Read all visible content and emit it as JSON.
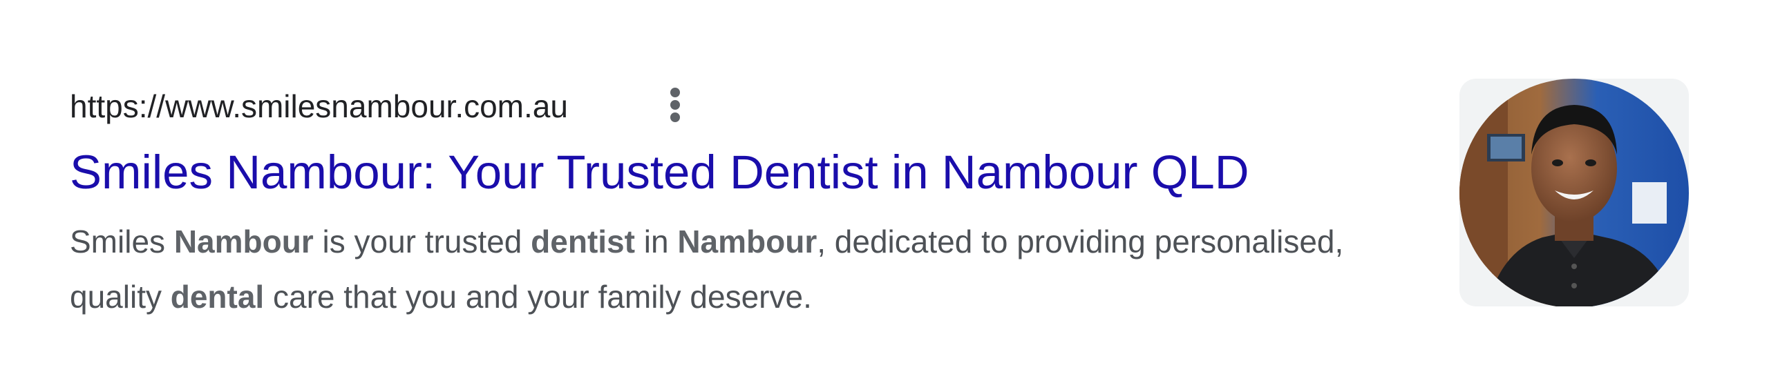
{
  "result": {
    "url": "https://www.smilesnambour.com.au",
    "more_icon": "three-dots-vertical-icon",
    "title": "Smiles Nambour: Your Trusted Dentist in Nambour QLD",
    "snippet": [
      {
        "text": "Smiles ",
        "bold": false
      },
      {
        "text": "Nambour",
        "bold": true
      },
      {
        "text": " is your trusted ",
        "bold": false
      },
      {
        "text": "dentist",
        "bold": true
      },
      {
        "text": " in ",
        "bold": false
      },
      {
        "text": "Nambour",
        "bold": true
      },
      {
        "text": ", dedicated to providing personalised, quality ",
        "bold": false
      },
      {
        "text": "dental",
        "bold": true
      },
      {
        "text": " care that you and your family deserve.",
        "bold": false
      }
    ],
    "thumbnail": "dentist-portrait-photo"
  },
  "colors": {
    "title_link": "#1a0dab",
    "url_text": "#202124",
    "snippet_text": "#4d5156",
    "thumbnail_bg_blue": "#1e4fa8"
  }
}
